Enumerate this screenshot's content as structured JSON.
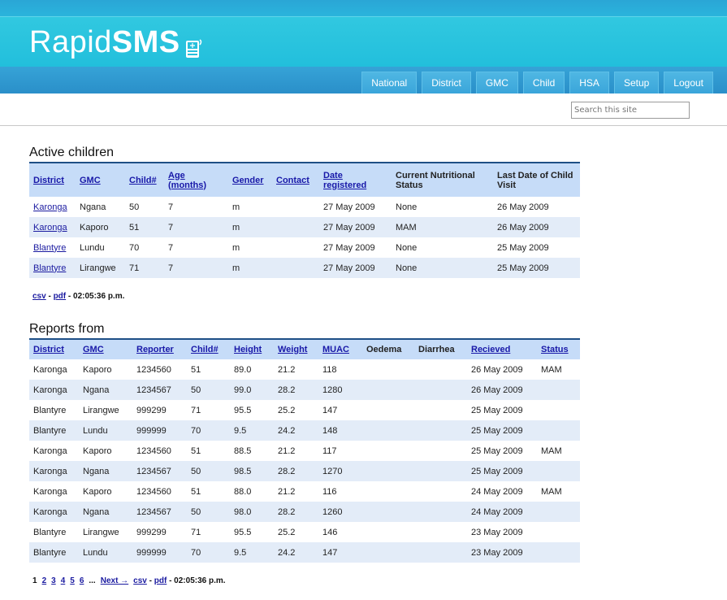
{
  "brand": {
    "light": "Rapid",
    "bold": "SMS"
  },
  "nav": [
    "National",
    "District",
    "GMC",
    "Child",
    "HSA",
    "Setup",
    "Logout"
  ],
  "search": {
    "placeholder": "Search this site"
  },
  "active": {
    "title": "Active children",
    "headers": [
      {
        "label": "District",
        "link": true
      },
      {
        "label": "GMC",
        "link": true
      },
      {
        "label": "Child#",
        "link": true
      },
      {
        "label": "Age (months)",
        "link": true
      },
      {
        "label": "Gender",
        "link": true
      },
      {
        "label": "Contact",
        "link": true
      },
      {
        "label": "Date registered",
        "link": true
      },
      {
        "label": "Current Nutritional Status",
        "link": false
      },
      {
        "label": "Last Date of Child Visit",
        "link": false
      }
    ],
    "rows": [
      [
        "Karonga",
        "Ngana",
        "50",
        "7",
        "m",
        "",
        "27 May 2009",
        "None",
        "26 May 2009"
      ],
      [
        "Karonga",
        "Kaporo",
        "51",
        "7",
        "m",
        "",
        "27 May 2009",
        "MAM",
        "26 May 2009"
      ],
      [
        "Blantyre",
        "Lundu",
        "70",
        "7",
        "m",
        "",
        "27 May 2009",
        "None",
        "25 May 2009"
      ],
      [
        "Blantyre",
        "Lirangwe",
        "71",
        "7",
        "m",
        "",
        "27 May 2009",
        "None",
        "25 May 2009"
      ]
    ],
    "footer": {
      "csv": "csv",
      "sep": " - ",
      "pdf": "pdf",
      "time": " - 02:05:36 p.m."
    }
  },
  "reports": {
    "title": "Reports from",
    "headers": [
      {
        "label": "District",
        "link": true
      },
      {
        "label": "GMC",
        "link": true
      },
      {
        "label": "Reporter",
        "link": true
      },
      {
        "label": "Child#",
        "link": true
      },
      {
        "label": "Height",
        "link": true
      },
      {
        "label": "Weight",
        "link": true
      },
      {
        "label": "MUAC",
        "link": true
      },
      {
        "label": "Oedema",
        "link": false
      },
      {
        "label": "Diarrhea",
        "link": false
      },
      {
        "label": "Recieved",
        "link": true
      },
      {
        "label": "Status",
        "link": true
      }
    ],
    "rows": [
      [
        "Karonga",
        "Kaporo",
        "1234560",
        "51",
        "89.0",
        "21.2",
        "118",
        "",
        "",
        "26 May 2009",
        "MAM"
      ],
      [
        "Karonga",
        "Ngana",
        "1234567",
        "50",
        "99.0",
        "28.2",
        "1280",
        "",
        "",
        "26 May 2009",
        ""
      ],
      [
        "Blantyre",
        "Lirangwe",
        "999299",
        "71",
        "95.5",
        "25.2",
        "147",
        "",
        "",
        "25 May 2009",
        ""
      ],
      [
        "Blantyre",
        "Lundu",
        "999999",
        "70",
        "9.5",
        "24.2",
        "148",
        "",
        "",
        "25 May 2009",
        ""
      ],
      [
        "Karonga",
        "Kaporo",
        "1234560",
        "51",
        "88.5",
        "21.2",
        "117",
        "",
        "",
        "25 May 2009",
        "MAM"
      ],
      [
        "Karonga",
        "Ngana",
        "1234567",
        "50",
        "98.5",
        "28.2",
        "1270",
        "",
        "",
        "25 May 2009",
        ""
      ],
      [
        "Karonga",
        "Kaporo",
        "1234560",
        "51",
        "88.0",
        "21.2",
        "116",
        "",
        "",
        "24 May 2009",
        "MAM"
      ],
      [
        "Karonga",
        "Ngana",
        "1234567",
        "50",
        "98.0",
        "28.2",
        "1260",
        "",
        "",
        "24 May 2009",
        ""
      ],
      [
        "Blantyre",
        "Lirangwe",
        "999299",
        "71",
        "95.5",
        "25.2",
        "146",
        "",
        "",
        "23 May 2009",
        ""
      ],
      [
        "Blantyre",
        "Lundu",
        "999999",
        "70",
        "9.5",
        "24.2",
        "147",
        "",
        "",
        "23 May 2009",
        ""
      ]
    ],
    "pager": {
      "current": "1",
      "pages": [
        "2",
        "3",
        "4",
        "5",
        "6"
      ],
      "ellipsis": "...",
      "next": "Next →",
      "csv": "csv",
      "pdf": "pdf",
      "sep": " - ",
      "time": " - 02:05:36 p.m."
    }
  }
}
